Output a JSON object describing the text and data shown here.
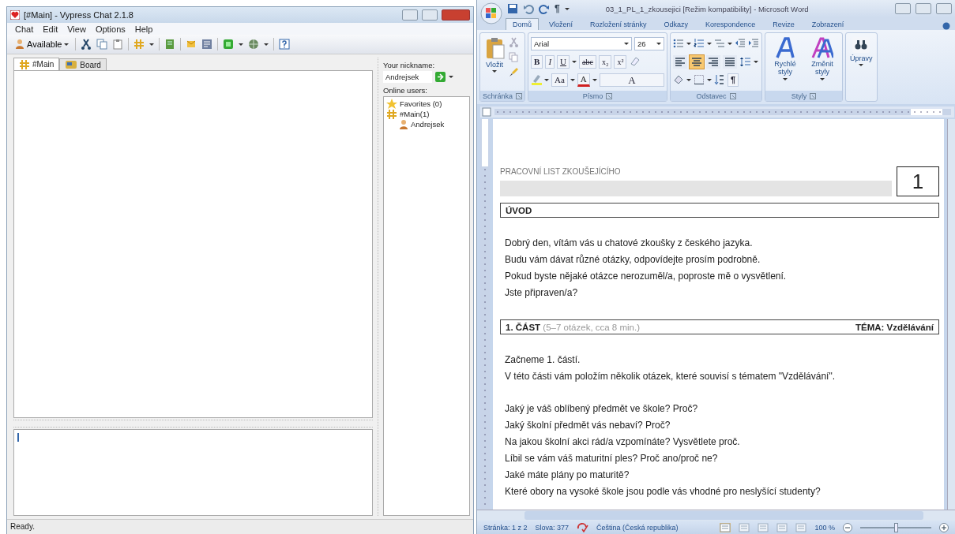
{
  "chat_window": {
    "title": "[#Main] - Vypress Chat 2.1.8",
    "menu": [
      "Chat",
      "Edit",
      "View",
      "Options",
      "Help"
    ],
    "status_button": "Available",
    "tabs": [
      {
        "label": "#Main",
        "kind": "channel",
        "selected": true
      },
      {
        "label": "Board",
        "kind": "board",
        "selected": false
      }
    ],
    "nickname_label": "Your nickname:",
    "nickname": "Andrejsek",
    "users_label": "Online users:",
    "users": [
      {
        "label": "Favorites (0)",
        "kind": "favorites"
      },
      {
        "label": "#Main(1)",
        "kind": "channel",
        "children": [
          {
            "label": "Andrejsek",
            "kind": "user"
          }
        ]
      }
    ],
    "status_bar": "Ready."
  },
  "word_window": {
    "title": "03_1_PL_1_zkousejici [Režim kompatibility] - Microsoft Word",
    "ribbon_tabs": [
      {
        "label": "Domů",
        "selected": true
      },
      {
        "label": "Vložení",
        "selected": false
      },
      {
        "label": "Rozložení stránky",
        "selected": false
      },
      {
        "label": "Odkazy",
        "selected": false
      },
      {
        "label": "Korespondence",
        "selected": false
      },
      {
        "label": "Revize",
        "selected": false
      },
      {
        "label": "Zobrazení",
        "selected": false
      }
    ],
    "paste_label": "Vložit",
    "font": "Arial",
    "font_size": "26",
    "format_buttons": [
      "B",
      "I",
      "U",
      "abc",
      "x₂",
      "x²"
    ],
    "font_buttons": [
      "Aa",
      "A",
      "A"
    ],
    "alignment": [
      {
        "kind": "left",
        "selected": false
      },
      {
        "kind": "center",
        "selected": true
      },
      {
        "kind": "right",
        "selected": false
      },
      {
        "kind": "justify",
        "selected": false
      }
    ],
    "pilcrow": "¶",
    "styles_buttons": [
      "Rychlé styly",
      "Změnit styly"
    ],
    "editing_label": "Úpravy",
    "groups": [
      "Schránka",
      "Písmo",
      "Odstavec",
      "Styly"
    ],
    "document": {
      "header": "PRACOVNÍ LIST ZKOUŠEJÍCÍHO",
      "page_number": "1",
      "blocks": [
        {
          "kind": "section",
          "title": "ÚVOD"
        },
        {
          "kind": "paragraphs",
          "lines": [
            "Dobrý den, vítám vás u chatové zkoušky z českého jazyka.",
            "Budu vám dávat různé otázky, odpovídejte prosím podrobně.",
            "Pokud byste nějaké otázce nerozuměl/a, poproste mě o vysvětlení.",
            "Jste připraven/a?"
          ]
        },
        {
          "kind": "section",
          "title": "1. ČÁST",
          "note": "(5–7 otázek, cca 8 min.)",
          "topic": "TÉMA: Vzdělávání"
        },
        {
          "kind": "paragraphs",
          "lines": [
            "Začneme 1. částí.",
            "V této části vám položím několik otázek, které souvisí s tématem \"Vzdělávání\"."
          ]
        },
        {
          "kind": "paragraphs",
          "lines": [
            "Jaký je váš oblíbený předmět ve škole? Proč?",
            "Jaký školní předmět vás nebaví? Proč?",
            "Na jakou školní akci rád/a vzpomínáte? Vysvětlete proč.",
            "Líbil se vám váš maturitní ples? Proč ano/proč ne?",
            "Jaké máte plány po maturitě?",
            "Které obory na vysoké škole jsou podle vás vhodné pro neslyšící studenty?"
          ]
        }
      ]
    },
    "status": {
      "page": "Stránka: 1 z 2",
      "words": "Slova: 377",
      "language": "Čeština (Česká republika)",
      "zoom": "100 %",
      "zoom_slider": {
        "level": 0.5
      },
      "views": [
        {
          "selected": true
        },
        {
          "selected": false
        },
        {
          "selected": false
        },
        {
          "selected": false
        },
        {
          "selected": false
        }
      ]
    }
  }
}
